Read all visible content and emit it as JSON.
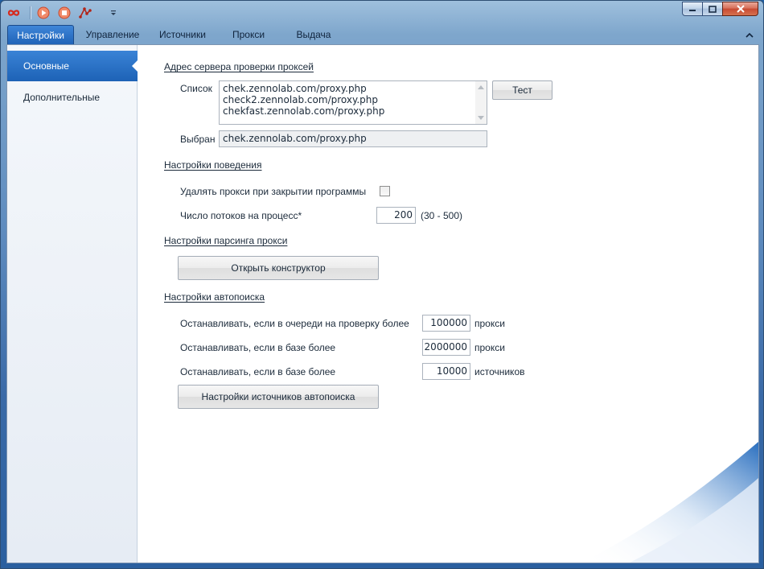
{
  "window": {
    "tabs": [
      "Настройки",
      "Управление",
      "Источники",
      "Прокси",
      "Выдача"
    ],
    "active_tab": 0
  },
  "sidebar": {
    "items": [
      {
        "label": "Основные",
        "active": true
      },
      {
        "label": "Дополнительные",
        "active": false
      }
    ]
  },
  "proxy_check": {
    "section_title": "Адрес сервера проверки проксей",
    "list_label": "Список",
    "list_items": [
      "chek.zennolab.com/proxy.php",
      "check2.zennolab.com/proxy.php",
      "chekfast.zennolab.com/proxy.php"
    ],
    "test_button": "Тест",
    "selected_label": "Выбран",
    "selected_value": "chek.zennolab.com/proxy.php"
  },
  "behavior": {
    "section_title": "Настройки поведения",
    "delete_on_close_label": "Удалять прокси при закрытии программы",
    "delete_on_close_checked": false,
    "threads_label": "Число потоков на процесс*",
    "threads_value": "200",
    "threads_range": "(30 - 500)"
  },
  "parsing": {
    "section_title": "Настройки парсинга прокси",
    "open_constructor_button": "Открыть конструктор"
  },
  "autosearch": {
    "section_title": "Настройки автопоиска",
    "rows": [
      {
        "label": "Останавливать, если в очереди на проверку более",
        "value": "100000",
        "unit": "прокси"
      },
      {
        "label": "Останавливать, если в базе более",
        "value": "2000000",
        "unit": "прокси"
      },
      {
        "label": "Останавливать, если в базе более",
        "value": "10000",
        "unit": "источников"
      }
    ],
    "sources_button": "Настройки источников автопоиска"
  },
  "colors": {
    "accent": "#1f63b8",
    "close_button": "#c74a33"
  }
}
